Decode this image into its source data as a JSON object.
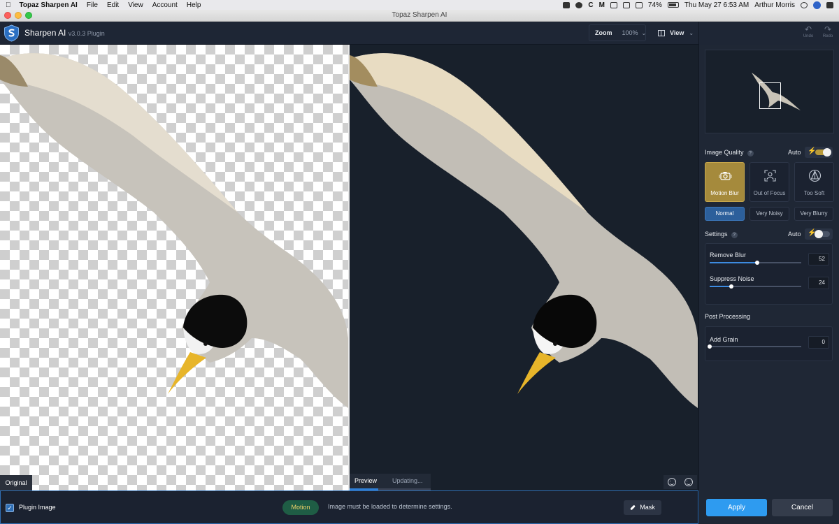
{
  "menubar": {
    "app_name": "Topaz Sharpen AI",
    "menus": [
      "File",
      "Edit",
      "View",
      "Account",
      "Help"
    ],
    "battery": "74%",
    "datetime": "Thu May 27  6:53 AM",
    "user": "Arthur Morris"
  },
  "window": {
    "title": "Topaz Sharpen AI"
  },
  "header": {
    "brand": "Sharpen AI",
    "version": "v3.0.3 Plugin",
    "zoom_label": "Zoom",
    "zoom_value": "100%",
    "view_label": "View",
    "undo_label": "Undo",
    "redo_label": "Redo"
  },
  "canvas": {
    "original_label": "Original",
    "preview_tab": "Preview",
    "updating_text": "Updating...",
    "progress": 0.35
  },
  "bottom": {
    "plugin_image_label": "Plugin Image",
    "plugin_image_checked": true,
    "motion_badge": "Motion",
    "message": "Image must be loaded to determine settings.",
    "mask_label": "Mask"
  },
  "sidebar": {
    "image_quality": {
      "title": "Image Quality",
      "auto_label": "Auto",
      "auto_on": true,
      "modes": [
        {
          "label": "Motion Blur",
          "icon": "motion-blur-camera-icon",
          "active": true
        },
        {
          "label": "Out of Focus",
          "icon": "out-of-focus-icon",
          "active": false
        },
        {
          "label": "Too Soft",
          "icon": "too-soft-icon",
          "active": false
        }
      ],
      "levels": [
        {
          "label": "Normal",
          "active": true
        },
        {
          "label": "Very Noisy",
          "active": false
        },
        {
          "label": "Very Blurry",
          "active": false
        }
      ]
    },
    "settings": {
      "title": "Settings",
      "auto_label": "Auto",
      "auto_on": false,
      "remove_blur": {
        "label": "Remove Blur",
        "value": 52
      },
      "suppress_noise": {
        "label": "Suppress Noise",
        "value": 24
      }
    },
    "post_processing": {
      "title": "Post Processing",
      "add_grain": {
        "label": "Add Grain",
        "value": 0
      }
    },
    "apply_label": "Apply",
    "cancel_label": "Cancel"
  },
  "colors": {
    "accent_gold": "#a58a3c",
    "accent_blue": "#2e9bf0",
    "panel_bg": "#1f2735"
  }
}
